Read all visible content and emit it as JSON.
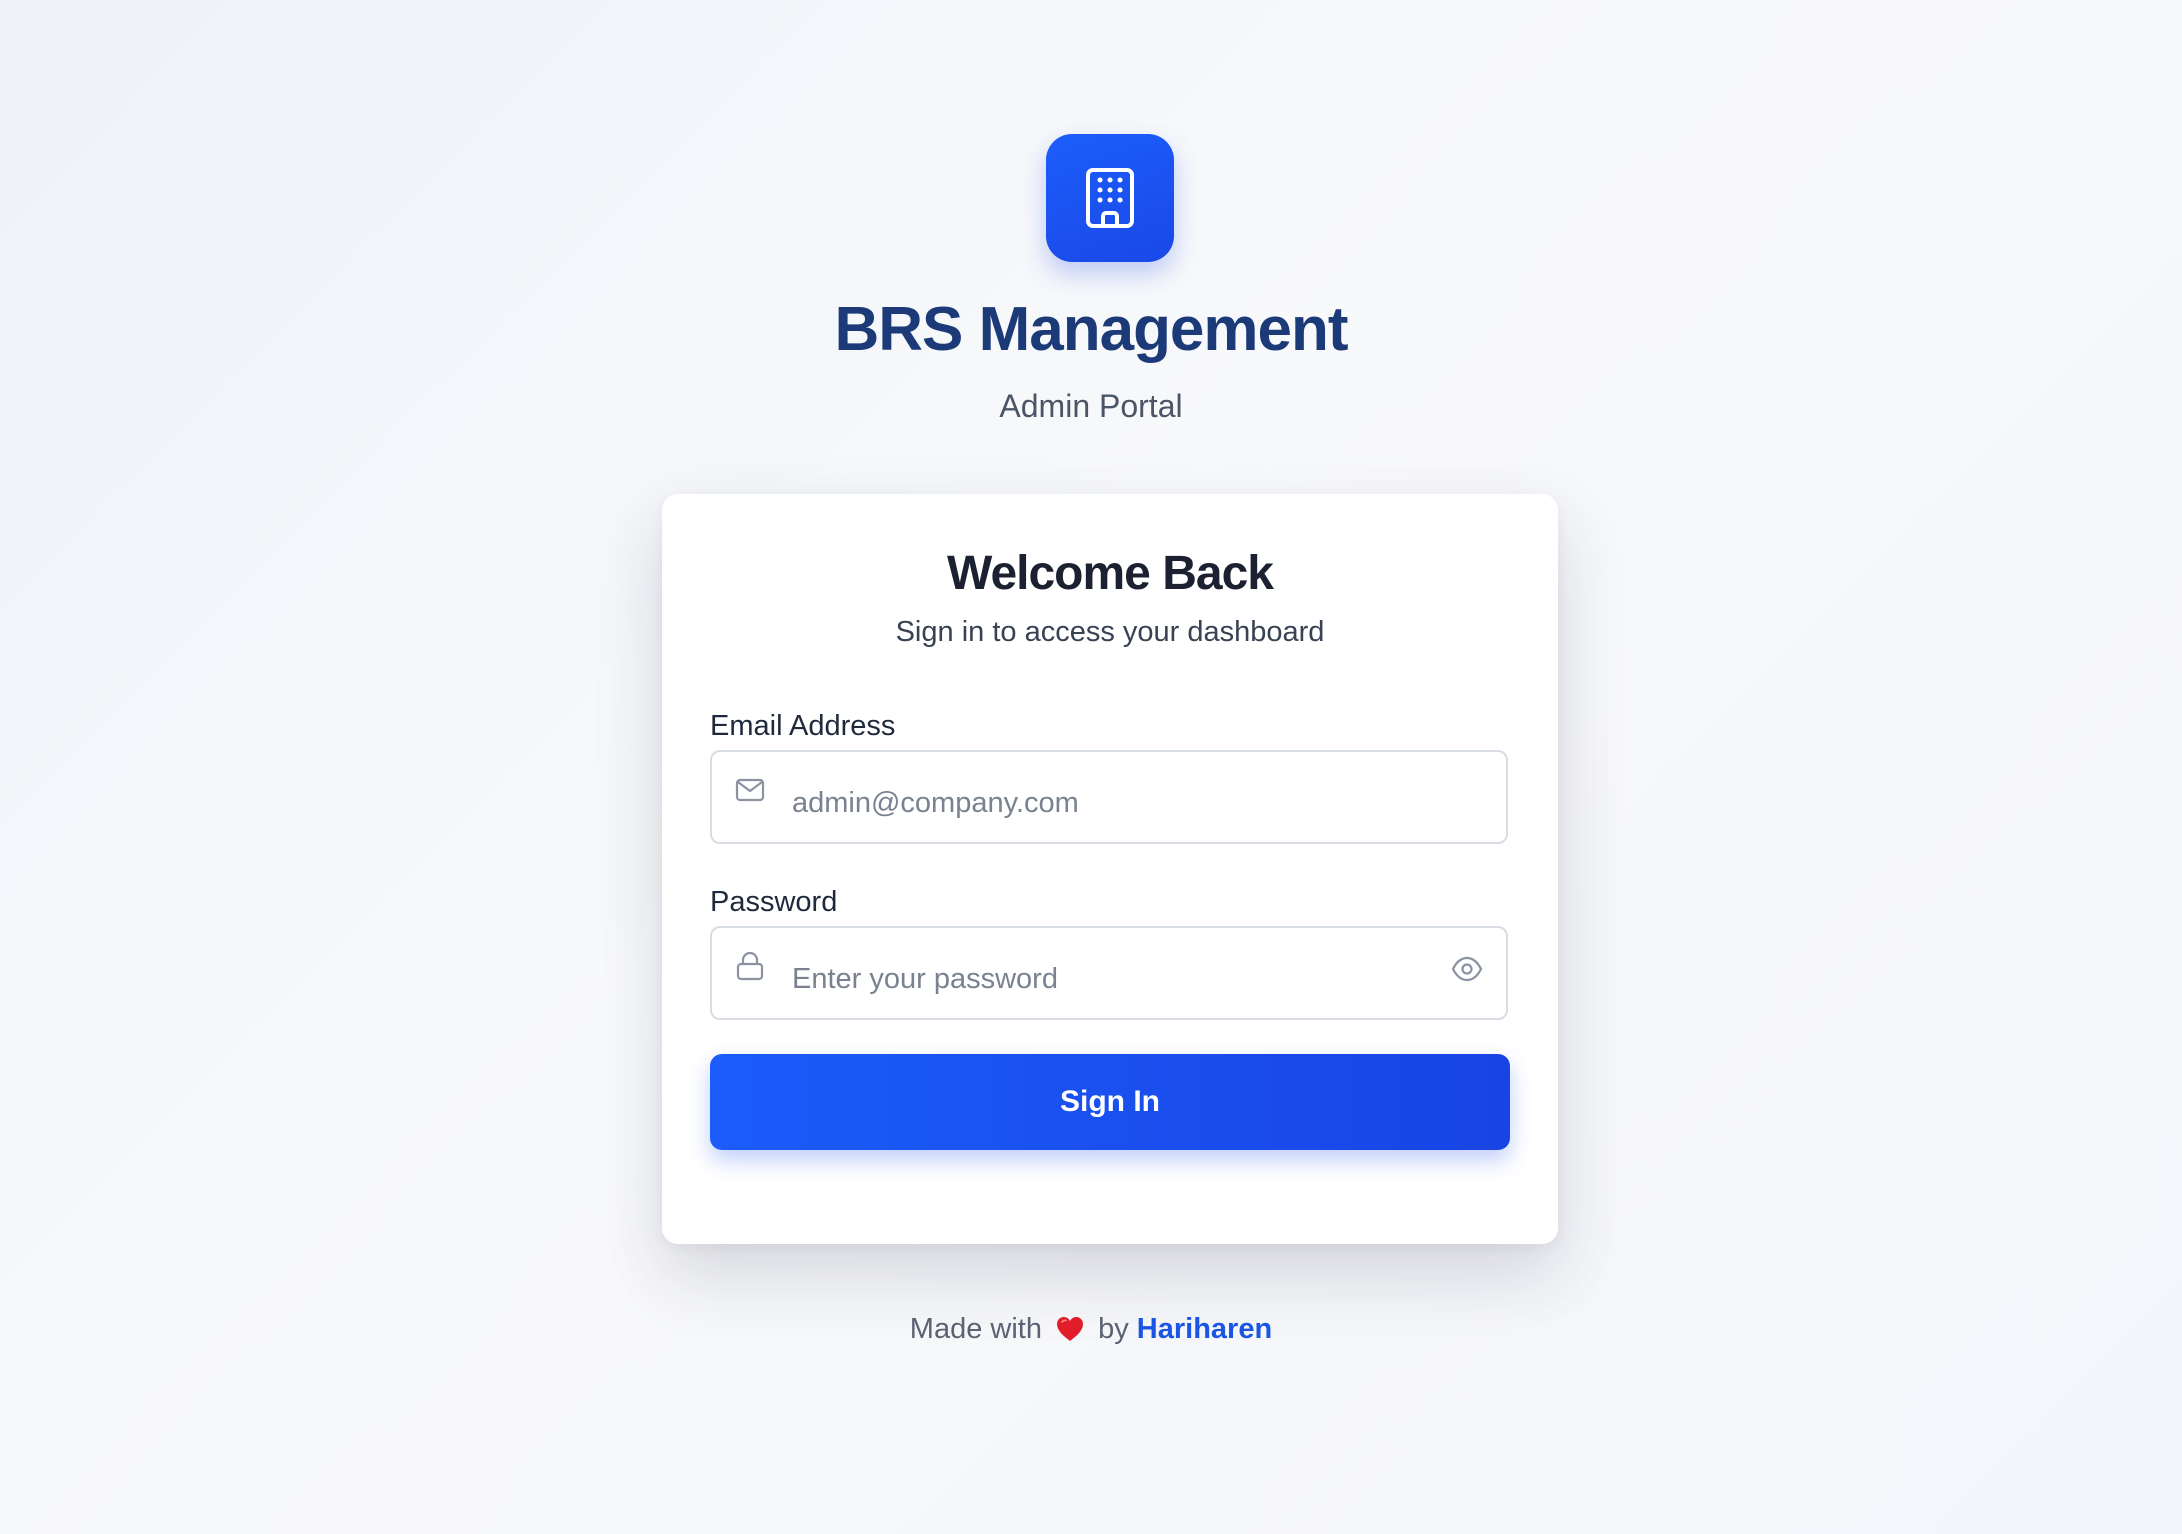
{
  "brand": {
    "title": "BRS Management",
    "subtitle": "Admin Portal",
    "logo_icon": "building-icon",
    "accent_color": "#1b5cfa"
  },
  "card": {
    "title": "Welcome Back",
    "subtitle": "Sign in to access your dashboard"
  },
  "form": {
    "email": {
      "label": "Email Address",
      "placeholder": "admin@company.com",
      "value": "",
      "icon": "mail-icon"
    },
    "password": {
      "label": "Password",
      "placeholder": "Enter your password",
      "value": "",
      "icon": "lock-icon",
      "toggle_icon": "eye-icon"
    },
    "submit_label": "Sign In"
  },
  "footer": {
    "prefix": "Made with",
    "heart_icon": "heart-icon",
    "middle": "by",
    "author": "Hariharen"
  }
}
